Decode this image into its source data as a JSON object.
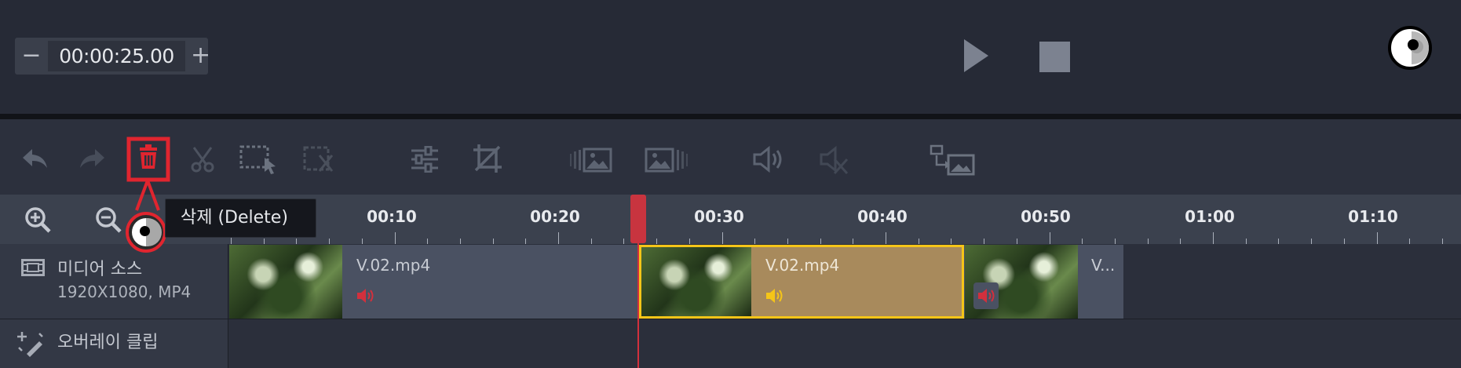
{
  "timecode": {
    "value": "00:00:25.00",
    "minus": "−",
    "plus": "+"
  },
  "toolbar": {
    "icons": [
      "undo-icon",
      "redo-icon",
      "delete-icon",
      "cut-icon",
      "select-icon",
      "split-icon",
      "adjust-icon",
      "crop-icon",
      "fade-in-icon",
      "fade-out-icon",
      "volume-icon",
      "mute-icon",
      "replace-icon"
    ]
  },
  "tooltip": {
    "text": "삭제 (Delete)"
  },
  "ruler": {
    "labels": [
      "00:10",
      "00:20",
      "00:30",
      "00:40",
      "00:50",
      "01:00",
      "01:10"
    ]
  },
  "tracks": {
    "media": {
      "title": "미디어 소스",
      "subtitle": "1920X1080, MP4"
    },
    "overlay": {
      "title": "오버레이 클립"
    }
  },
  "clips": [
    {
      "label": "V.02.mp4",
      "state": "normal"
    },
    {
      "label": "V.02.mp4",
      "state": "selected"
    },
    {
      "label": "V...",
      "state": "normal"
    }
  ],
  "colors": {
    "accent_red": "#d2303d",
    "selected_clip": "#a88a5c",
    "selected_border": "#f5c518"
  }
}
